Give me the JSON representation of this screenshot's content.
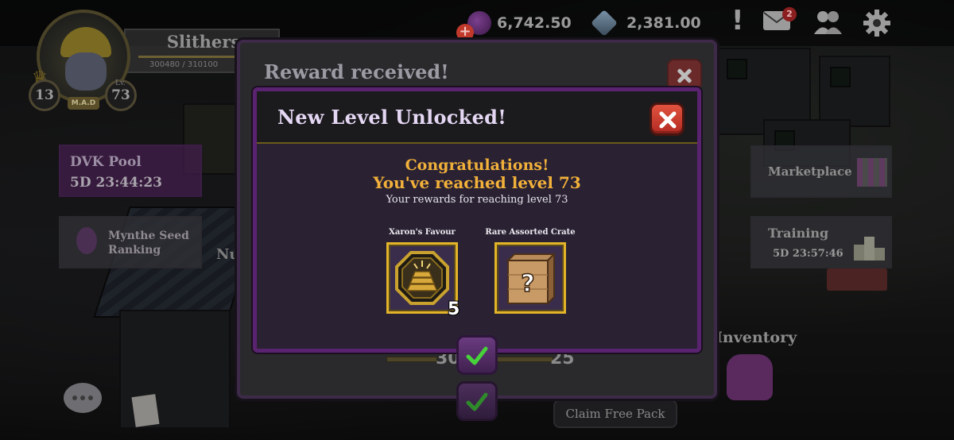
{
  "hud": {
    "premium_currency": "6,742.50",
    "gem_currency": "2,381.00",
    "mail_badge": "2",
    "add_symbol": "+"
  },
  "player": {
    "name": "Slithers",
    "xp_text": "300480 / 310100",
    "xp_progress": 0.969,
    "rank_level": "13",
    "level": "73",
    "level_tag": "Lv.",
    "guild_tag": "M.A.D"
  },
  "side_panels": {
    "dvk_pool_title": "DVK Pool",
    "dvk_pool_timer": "5D 23:44:23",
    "mynthe_title": "Mynthe Seed Ranking",
    "nu_label": "Nu",
    "marketplace": "Marketplace",
    "training_title": "Training",
    "training_timer": "5D 23:57:46",
    "inventory": "Inventory",
    "claim_free_pack": "Claim Free Pack"
  },
  "back_modal": {
    "title": "Reward received!",
    "left_value": "30",
    "right_value": "25"
  },
  "modal": {
    "title": "New Level Unlocked!",
    "congrats_line1": "Congratulations!",
    "congrats_line2": "You've reached level 73",
    "subtitle": "Your rewards for reaching level 73",
    "rewards": [
      {
        "name": "Xaron's Favour",
        "quantity": "5",
        "icon": "gold-bars-emblem-icon"
      },
      {
        "name": "Rare Assorted Crate",
        "quantity": "",
        "icon": "mystery-crate-icon"
      }
    ]
  },
  "colors": {
    "accent_gold": "#f2b13a",
    "modal_border": "#5a2370",
    "close_red": "#d4443a",
    "check_green": "#47d13a"
  }
}
